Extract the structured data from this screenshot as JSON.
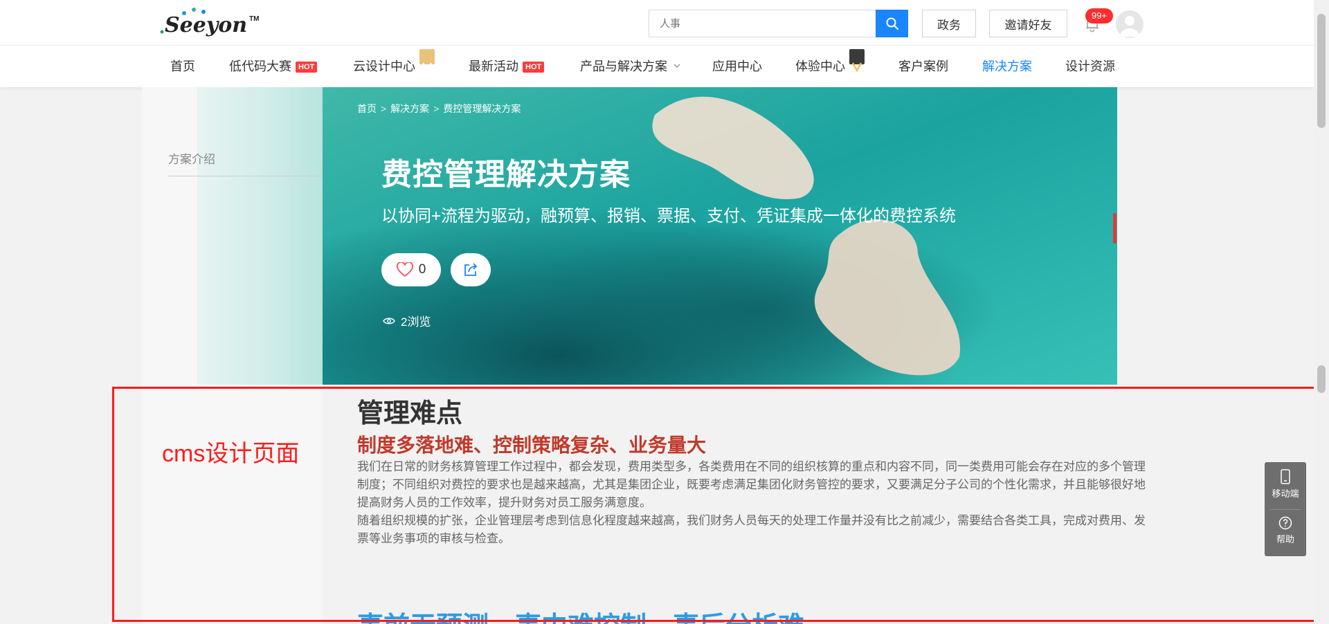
{
  "header": {
    "logo_text": "Seeyon",
    "logo_tm": "TM",
    "search": {
      "placeholder": "人事"
    },
    "btn_gov": "政务",
    "btn_invite": "邀请好友",
    "notification_count": "99+"
  },
  "nav": {
    "items": [
      {
        "label": "首页"
      },
      {
        "label": "低代码大赛",
        "badge": "HOT"
      },
      {
        "label": "云设计中心"
      },
      {
        "label": "最新活动",
        "badge": "HOT"
      },
      {
        "label": "产品与解决方案"
      },
      {
        "label": "应用中心"
      },
      {
        "label": "体验中心"
      },
      {
        "label": "客户案例"
      },
      {
        "label": "解决方案"
      },
      {
        "label": "设计资源"
      }
    ]
  },
  "sidebar": {
    "tab": "方案介绍"
  },
  "hero": {
    "breadcrumb": [
      "首页",
      "解决方案",
      "费控管理解决方案"
    ],
    "title": "费控管理解决方案",
    "subtitle": "以协同+流程为驱动，融预算、报销、票据、支付、凭证集成一体化的费控系统",
    "likes": "0",
    "views": "2浏览"
  },
  "content": {
    "section_title": "管理难点",
    "section_subtitle": "制度多落地难、控制策略复杂、业务量大",
    "para1_lines": [
      "我们在日常的财务核算管理工作过程中，都会发现，费用类型多，各类费用在不同的组织核算的重点和内容不同，同一类费用可能会存在对应的多个管理",
      "制度；不同组织对费控的要求也是越来越高，尤其是集团企业，既要考虑满足集团化财务管控的要求，又要满足分子公司的个性化需求，并且能够很好地",
      "提高财务人员的工作效率，提升财务对员工服务满意度。"
    ],
    "para2_lines": [
      "随着组织规模的扩张，企业管理层考虑到信息化程度越来越高，我们财务人员每天的处理工作量并没有比之前减少，需要结合各类工具，完成对费用、发",
      "票等业务事项的审核与检查。"
    ],
    "next_title": "事前无预测、事中难控制、事后分析难"
  },
  "annotation": {
    "label": "cms设计页面",
    "color": "#ff1a1a"
  },
  "float_panel": {
    "mobile": "移动端",
    "help": "帮助"
  },
  "colors": {
    "accent": "#1a85ff",
    "hot": "#ff3b3b",
    "subtitle_red": "#c0392b"
  }
}
